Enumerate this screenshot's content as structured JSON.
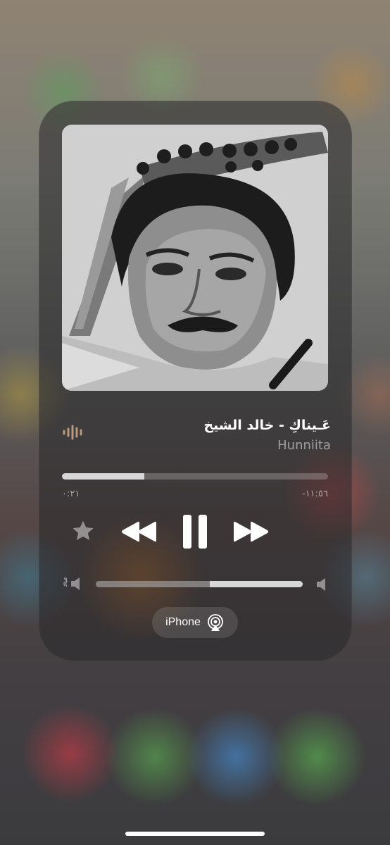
{
  "now_playing": {
    "title": "عَـيناكِ - خالد الشيخ",
    "artist": "Hunniita",
    "progress": 0.31,
    "elapsed": "٠:٢١",
    "remaining": "-١١:٥٦",
    "volume": 0.55
  },
  "output_device": {
    "label": "iPhone",
    "icon": "airplay-icon"
  },
  "controls": {
    "favorite_icon": "star-icon",
    "rewind_icon": "rewind-icon",
    "play_pause_icon": "pause-icon",
    "forward_icon": "fast-forward-icon",
    "volume_low_icon": "speaker-low-icon",
    "volume_high_icon": "speaker-high-icon"
  },
  "colors": {
    "accent": "#ffffff",
    "secondary_text": "rgba(255,255,255,0.5)"
  }
}
